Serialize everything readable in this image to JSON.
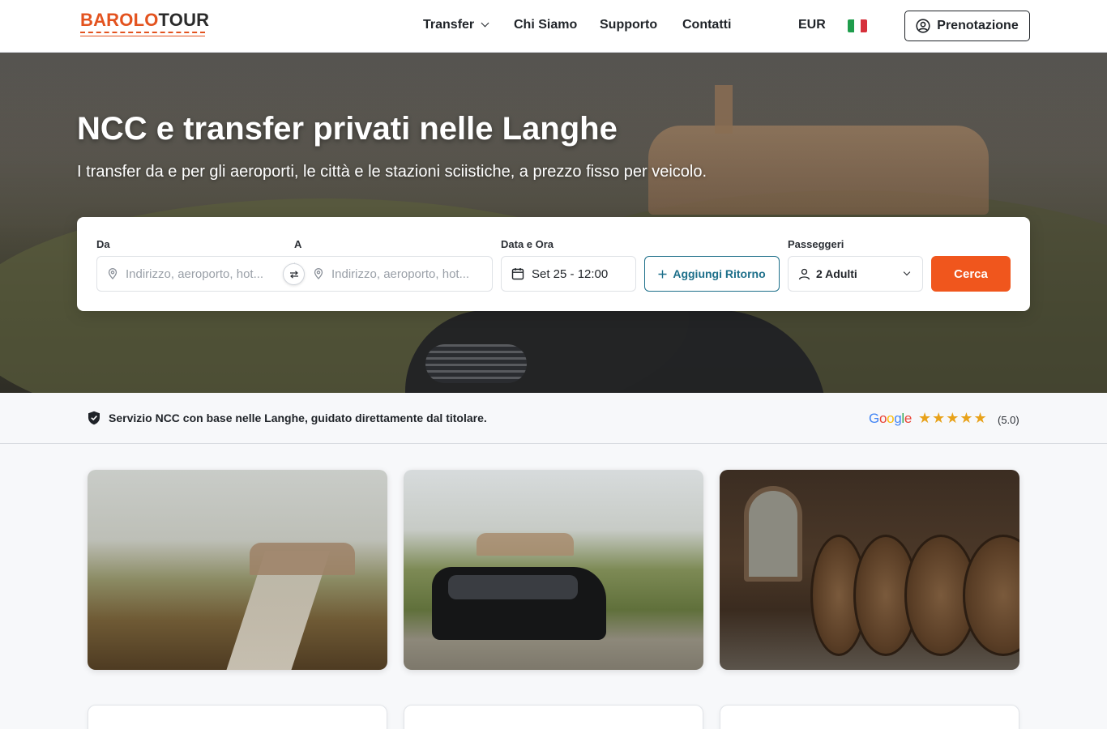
{
  "header": {
    "logo": {
      "part1": "BAROLO",
      "part2": "TOUR"
    },
    "nav": [
      {
        "label": "Transfer"
      },
      {
        "label": "Chi Siamo"
      },
      {
        "label": "Supporto"
      },
      {
        "label": "Contatti"
      }
    ],
    "currency": "EUR",
    "language_flag": "flag-italy-icon",
    "booking_button": "Prenotazione"
  },
  "hero": {
    "title": "NCC e transfer privati nelle Langhe",
    "subtitle": "I transfer da e per gli aeroporti, le città e le stazioni sciistiche, a prezzo fisso per veicolo."
  },
  "search": {
    "from_label": "Da",
    "from_placeholder": "Indirizzo, aeroporto, hot...",
    "to_label": "A",
    "to_placeholder": "Indirizzo, aeroporto, hot...",
    "date_label": "Data e Ora",
    "date_value": "Set 25 - 12:00",
    "return_button": "Aggiungi Ritorno",
    "passengers_label": "Passeggeri",
    "passengers_value": "2 Adulti",
    "search_button": "Cerca"
  },
  "trust": {
    "text": "Servizio NCC con base nelle Langhe, guidato direttamente dal titolare.",
    "review_source": "Google",
    "stars": "★★★★★",
    "rating": "(5.0)"
  },
  "colors": {
    "accent": "#f0561d",
    "teal": "#1d6f8a",
    "star": "#e8a21a"
  }
}
